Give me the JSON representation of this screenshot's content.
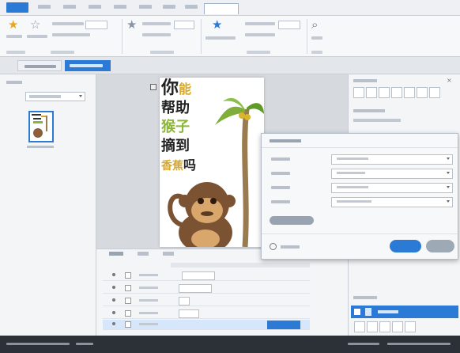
{
  "colors": {
    "accent": "#2b7bd6",
    "selected_tab": "#2b7bd6",
    "dialog_ok": "#2b7bd6",
    "status_bar": "#2c3138"
  },
  "icons": [
    "star-icon",
    "favorite-star-icon",
    "animation-star-icon",
    "preview-search-icon",
    "help-circle-icon"
  ],
  "slide": {
    "poster_lines": [
      "你",
      "能",
      "帮助",
      "猴子",
      "摘到",
      "香蕉",
      "吗"
    ]
  }
}
